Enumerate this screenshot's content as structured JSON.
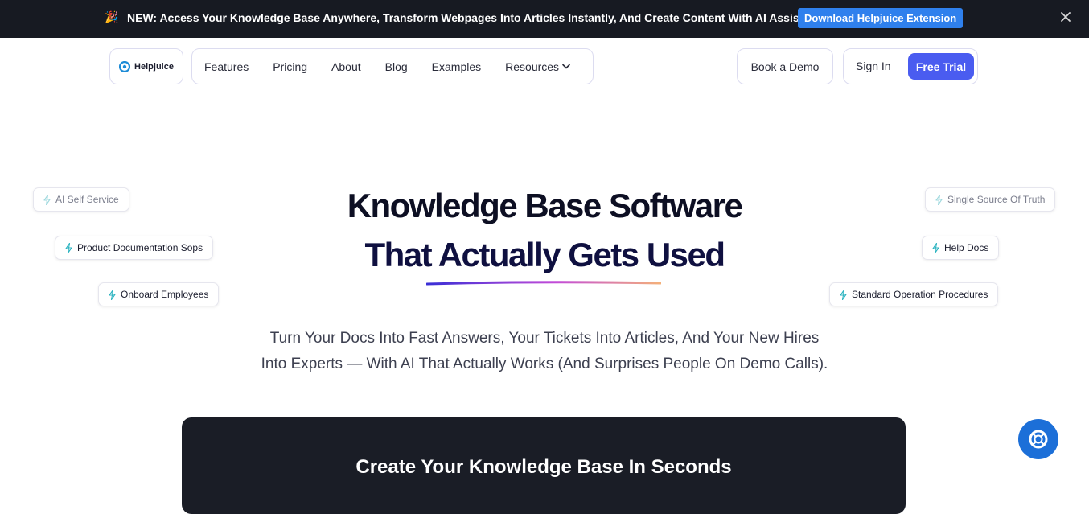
{
  "announcement": {
    "text": "NEW: Access Your Knowledge Base Anywhere, Transform Webpages Into Articles Instantly, And Create Content With AI Assistance",
    "button_label": "Download Helpjuice Extension"
  },
  "logo": {
    "text": "Helpjuice"
  },
  "nav": {
    "items": [
      "Features",
      "Pricing",
      "About",
      "Blog",
      "Examples",
      "Resources"
    ]
  },
  "actions": {
    "demo_label": "Book a Demo",
    "signin_label": "Sign In",
    "trial_label": "Free Trial"
  },
  "tags": {
    "left": [
      "AI Self Service",
      "Product Documentation Sops",
      "Onboard Employees"
    ],
    "right": [
      "Single Source Of Truth",
      "Help Docs",
      "Standard Operation Procedures"
    ]
  },
  "hero": {
    "title_line1": "Knowledge Base Software",
    "title_line2": "That Actually Gets Used",
    "subtitle_line1": "Turn Your Docs Into Fast Answers, Your Tickets Into Articles, And Your New Hires",
    "subtitle_line2": "Into Experts — With AI That Actually Works (And Surprises People On Demo Calls)."
  },
  "card": {
    "title": "Create Your Knowledge Base In Seconds"
  },
  "colors": {
    "accent": "#4a5cf0",
    "topbar_bg": "#171a22",
    "download_button": "#2f80ed",
    "bolt": "#2bb3c0",
    "help_bubble": "#1c6fd8"
  }
}
